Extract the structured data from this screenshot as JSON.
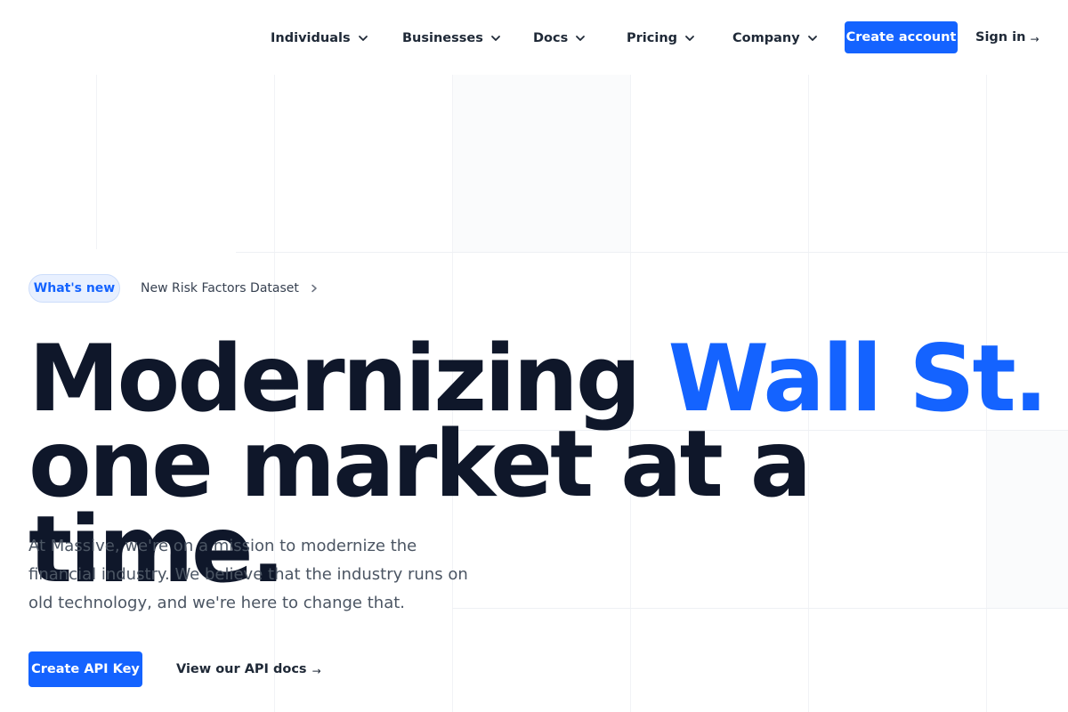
{
  "nav": {
    "items": [
      {
        "label": "Individuals",
        "icon": "chevron-down-icon"
      },
      {
        "label": "Businesses",
        "icon": "chevron-down-icon"
      },
      {
        "label": "Docs",
        "icon": "chevron-down-icon"
      },
      {
        "label": "Pricing",
        "icon": "chevron-down-icon"
      },
      {
        "label": "Company",
        "icon": "chevron-down-icon"
      }
    ],
    "create_account": "Create account",
    "sign_in": "Sign in",
    "sign_in_arrow": "→"
  },
  "hero": {
    "badge": "What's new",
    "announcement": "New Risk Factors Dataset",
    "headline_before": "Modernizing ",
    "headline_accent": "Wall St.",
    "headline_after": " one market at a time.",
    "lede": "At Massive, we're on a mission to modernize the financial industry. We believe that the industry runs on old technology, and we're here to change that.",
    "primary_cta": "Create API Key",
    "secondary_cta": "View our API docs",
    "secondary_arrow": "→"
  },
  "colors": {
    "accent": "#1463ff",
    "text": "#0f172a",
    "muted": "#4b5563",
    "badge_bg": "#e8f0ff"
  }
}
